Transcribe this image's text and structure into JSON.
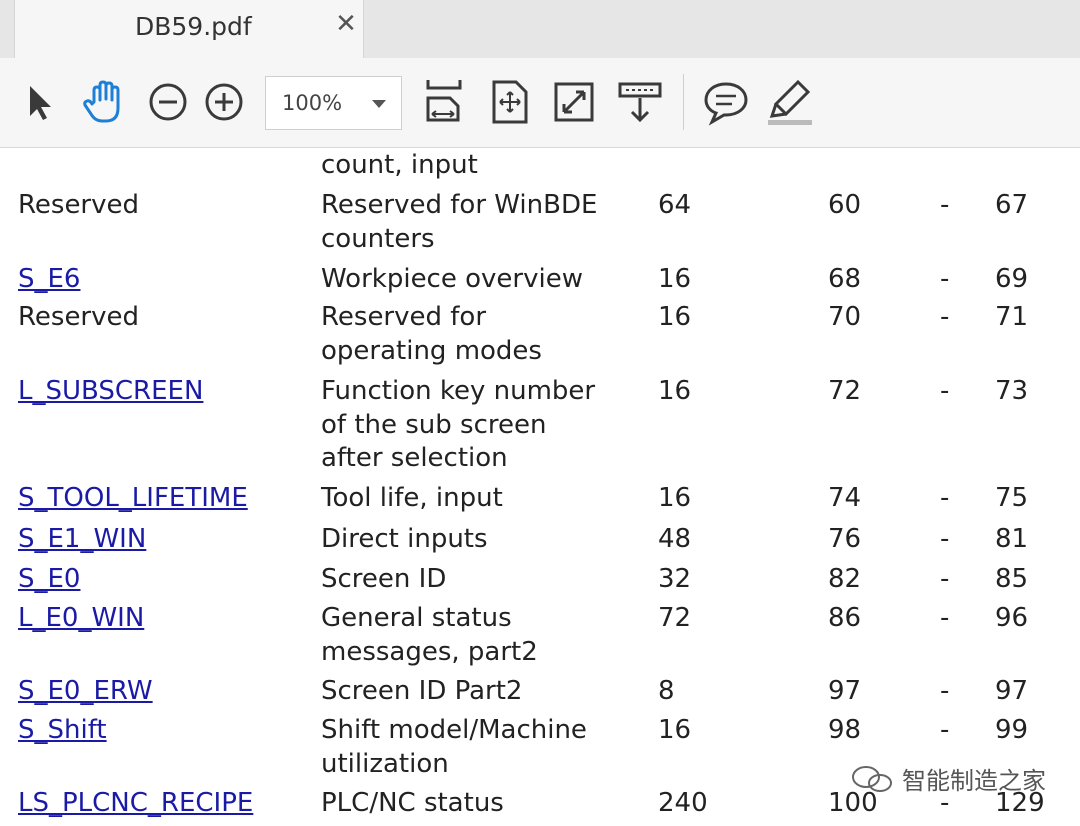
{
  "tab": {
    "title": "DB59.pdf",
    "close": "✕"
  },
  "toolbar": {
    "zoom_value": "100%"
  },
  "rows_top_partial": {
    "desc_line2": "count, input"
  },
  "rows": [
    {
      "name": "Reserved",
      "link": false,
      "desc": [
        "Reserved for WinBDE",
        "counters"
      ],
      "len": "64",
      "start": "60",
      "dash": "-",
      "end": "67"
    },
    {
      "name": "S_E6",
      "link": true,
      "desc": [
        "Workpiece overview"
      ],
      "len": "16",
      "start": "68",
      "dash": "-",
      "end": "69"
    },
    {
      "name": "Reserved",
      "link": false,
      "desc": [
        "Reserved for",
        "operating modes"
      ],
      "len": "16",
      "start": "70",
      "dash": "-",
      "end": "71"
    },
    {
      "name": "L_SUBSCREEN",
      "link": true,
      "desc": [
        "Function key number",
        "of the sub screen",
        "after selection"
      ],
      "len": "16",
      "start": "72",
      "dash": "-",
      "end": "73"
    },
    {
      "name": "S_TOOL_LIFETIME",
      "link": true,
      "desc": [
        "Tool life, input"
      ],
      "len": "16",
      "start": "74",
      "dash": "-",
      "end": "75"
    },
    {
      "name": "S_E1_WIN",
      "link": true,
      "desc": [
        "Direct inputs"
      ],
      "len": "48",
      "start": "76",
      "dash": "-",
      "end": "81"
    },
    {
      "name": "S_E0",
      "link": true,
      "desc": [
        "Screen ID"
      ],
      "len": "32",
      "start": "82",
      "dash": "-",
      "end": "85"
    },
    {
      "name": "L_E0_WIN",
      "link": true,
      "desc": [
        "General status",
        "messages, part2"
      ],
      "len": "72",
      "start": "86",
      "dash": "-",
      "end": "96"
    },
    {
      "name": "S_E0_ERW",
      "link": true,
      "desc": [
        "Screen ID Part2"
      ],
      "len": "8",
      "start": "97",
      "dash": "-",
      "end": "97"
    },
    {
      "name": "S_Shift",
      "link": true,
      "desc": [
        "Shift model/Machine",
        "utilization"
      ],
      "len": "16",
      "start": "98",
      "dash": "-",
      "end": "99"
    },
    {
      "name": "LS_PLCNC_RECIPE",
      "link": true,
      "desc": [
        "PLC/NC status"
      ],
      "len": "240",
      "start": "100",
      "dash": "-",
      "end": "129"
    }
  ],
  "watermark": {
    "text": "智能制造之家"
  },
  "colors": {
    "link": "#1a1aa6",
    "hand_icon": "#1e7fd6",
    "toolbar_bg": "#f6f6f6"
  }
}
